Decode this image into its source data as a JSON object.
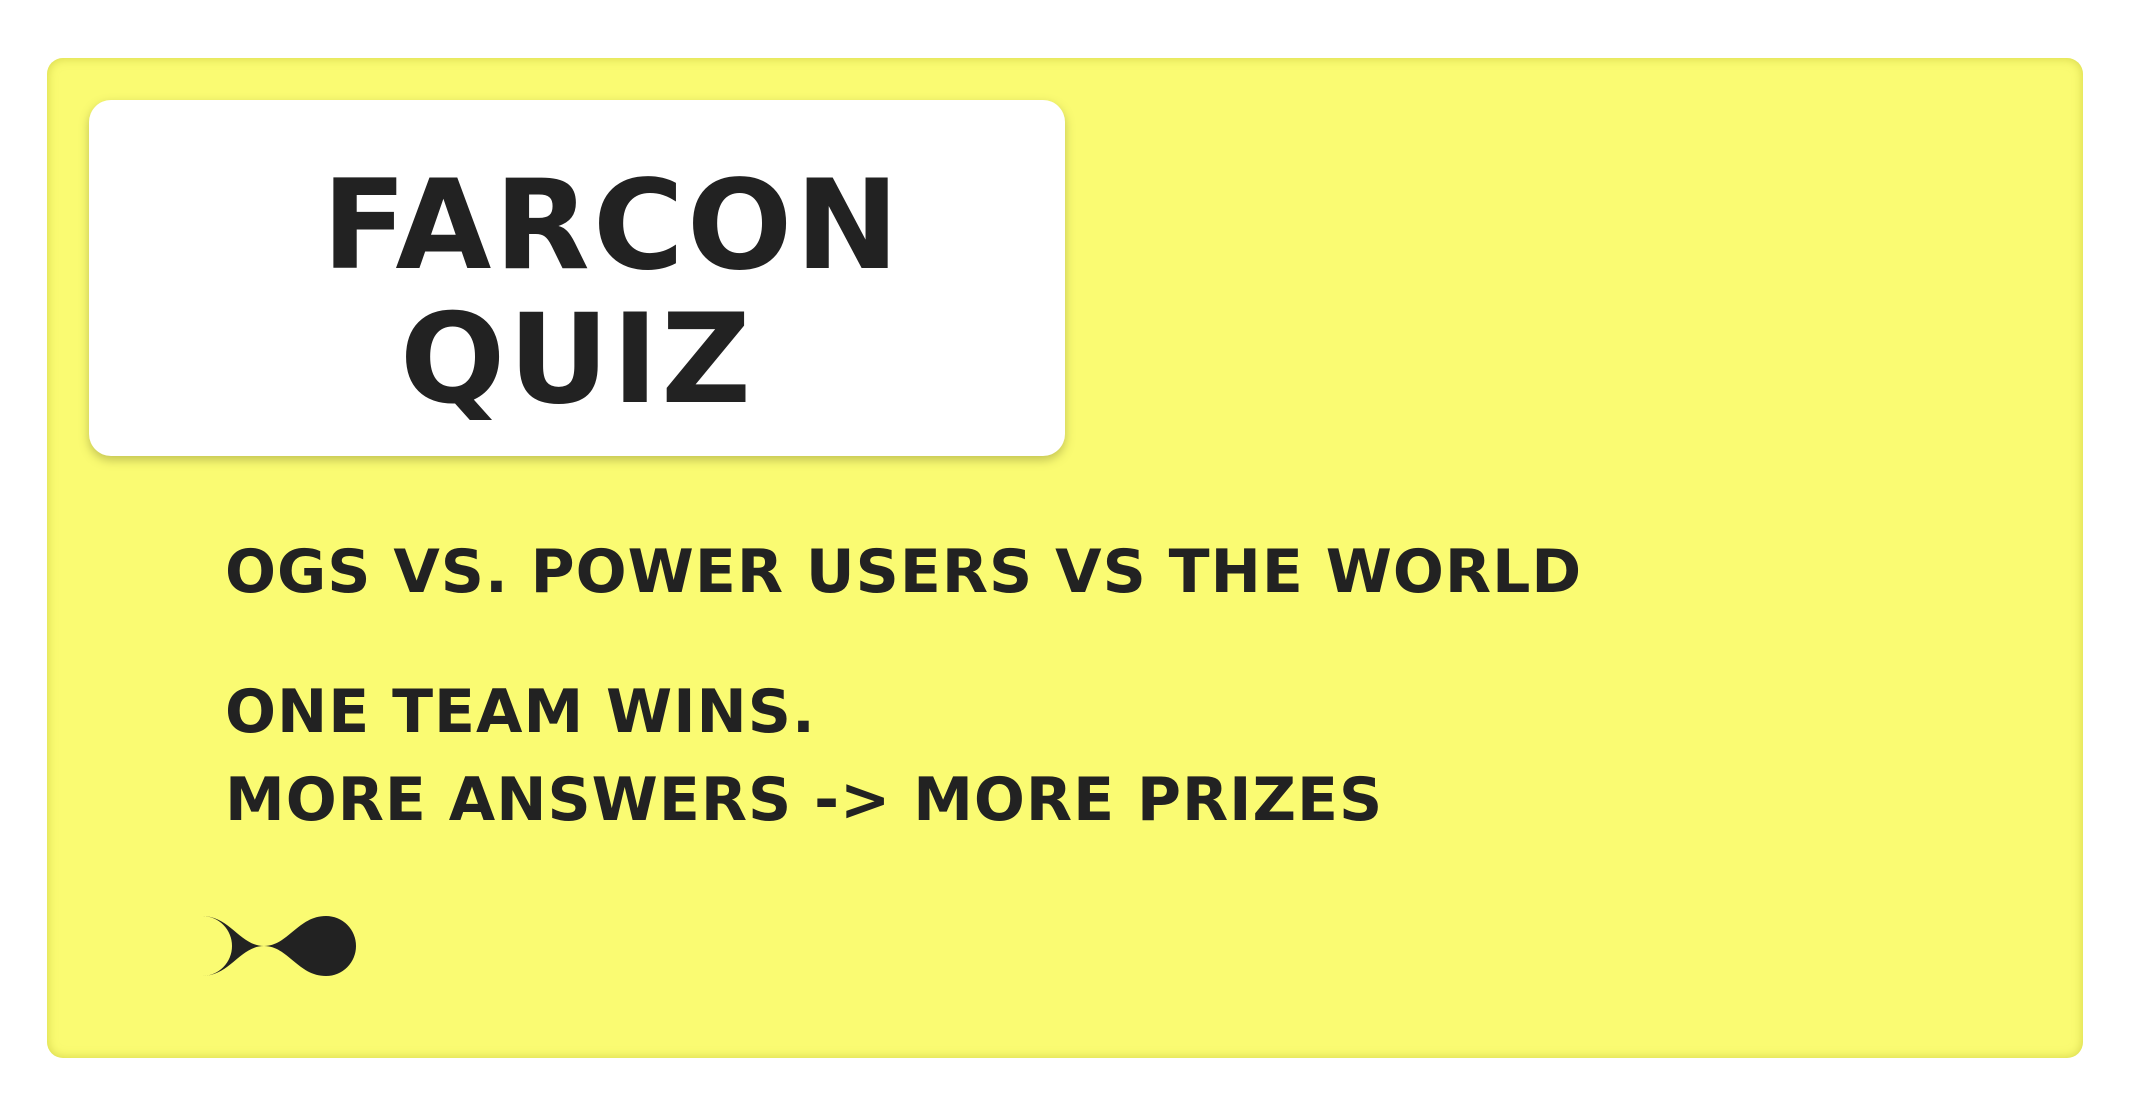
{
  "card": {
    "background_color": "#fafb72",
    "text_color": "#222222"
  },
  "title": {
    "line1": "FARCON",
    "line2": "QUIZ"
  },
  "taglines": [
    "OGS VS. POWER USERS VS THE WORLD",
    "ONE TEAM WINS.",
    "MORE ANSWERS -> MORE PRIZES"
  ],
  "logo": {
    "icon": "infinity-logo-icon"
  }
}
